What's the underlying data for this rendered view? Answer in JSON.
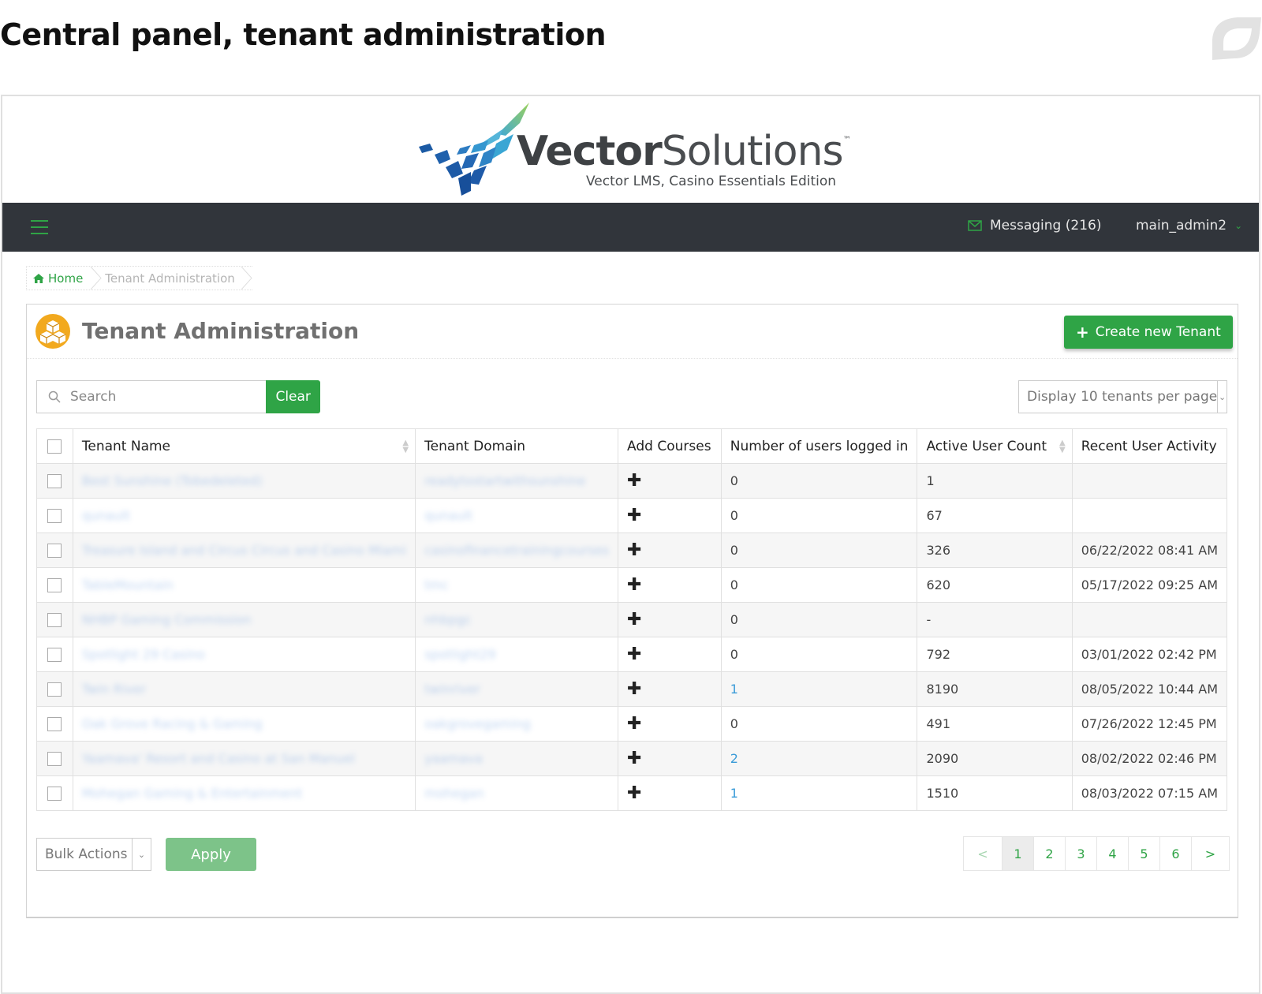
{
  "page_heading": "Central panel, tenant administration",
  "brand": {
    "name_bold": "Vector",
    "name_light": "Solutions",
    "trademark": "™",
    "edition": "Vector LMS, Casino Essentials Edition",
    "colors": {
      "primary_green": "#2fa446",
      "navbar": "#31353b",
      "logo_blue": "#1a5aa6",
      "logo_green": "#7cc36a"
    }
  },
  "navbar": {
    "menu_icon": "hamburger-icon",
    "messaging_icon": "envelope-icon",
    "messaging_label": "Messaging (216)",
    "user_label": "main_admin2",
    "user_chevron": "chevron-down-icon"
  },
  "breadcrumb": {
    "home_label": "Home",
    "current_label": "Tenant Administration"
  },
  "panel": {
    "title": "Tenant Administration",
    "icon": "boxes-icon",
    "create_button_label": "Create new Tenant",
    "search_placeholder": "Search",
    "search_value": "",
    "clear_label": "Clear",
    "per_page_selected": "Display 10 tenants per page"
  },
  "table": {
    "columns": [
      "",
      "Tenant Name",
      "Tenant Domain",
      "Add Courses",
      "Number of users logged in",
      "Active User Count",
      "Recent User Activity"
    ],
    "rows": [
      {
        "name": "Best Sunshine (Tobedeleted)",
        "domain": "readytostartwithsunshine",
        "logged_in": "0",
        "logged_link": false,
        "active": "1",
        "activity": ""
      },
      {
        "name": "qunault",
        "domain": "qunault",
        "logged_in": "0",
        "logged_link": false,
        "active": "67",
        "activity": ""
      },
      {
        "name": "Treasure Island and Circus Circus and Casino Miami",
        "domain": "casinofinancetrainingcourses",
        "logged_in": "0",
        "logged_link": false,
        "active": "326",
        "activity": "06/22/2022 08:41 AM"
      },
      {
        "name": "TableMountain",
        "domain": "tmc",
        "logged_in": "0",
        "logged_link": false,
        "active": "620",
        "activity": "05/17/2022 09:25 AM"
      },
      {
        "name": "NHBP Gaming Commission",
        "domain": "nhbpgc",
        "logged_in": "0",
        "logged_link": false,
        "active": "-",
        "activity": ""
      },
      {
        "name": "Spotlight 29 Casino",
        "domain": "spotlight29",
        "logged_in": "0",
        "logged_link": false,
        "active": "792",
        "activity": "03/01/2022 02:42 PM"
      },
      {
        "name": "Twin River",
        "domain": "twinriver",
        "logged_in": "1",
        "logged_link": true,
        "active": "8190",
        "activity": "08/05/2022 10:44 AM"
      },
      {
        "name": "Oak Grove Racing & Gaming",
        "domain": "oakgrovegaming",
        "logged_in": "0",
        "logged_link": false,
        "active": "491",
        "activity": "07/26/2022 12:45 PM"
      },
      {
        "name": "Yaamava' Resort and Casino at San Manuel",
        "domain": "yaamava",
        "logged_in": "2",
        "logged_link": true,
        "active": "2090",
        "activity": "08/02/2022 02:46 PM"
      },
      {
        "name": "Mohegan Gaming & Entertainment",
        "domain": "mohegan",
        "logged_in": "1",
        "logged_link": true,
        "active": "1510",
        "activity": "08/03/2022 07:15 AM"
      }
    ]
  },
  "footer": {
    "bulk_actions_selected": "Bulk Actions",
    "apply_label": "Apply",
    "pagination": {
      "prev": "<",
      "pages": [
        "1",
        "2",
        "3",
        "4",
        "5",
        "6"
      ],
      "current": "1",
      "next": ">"
    }
  }
}
